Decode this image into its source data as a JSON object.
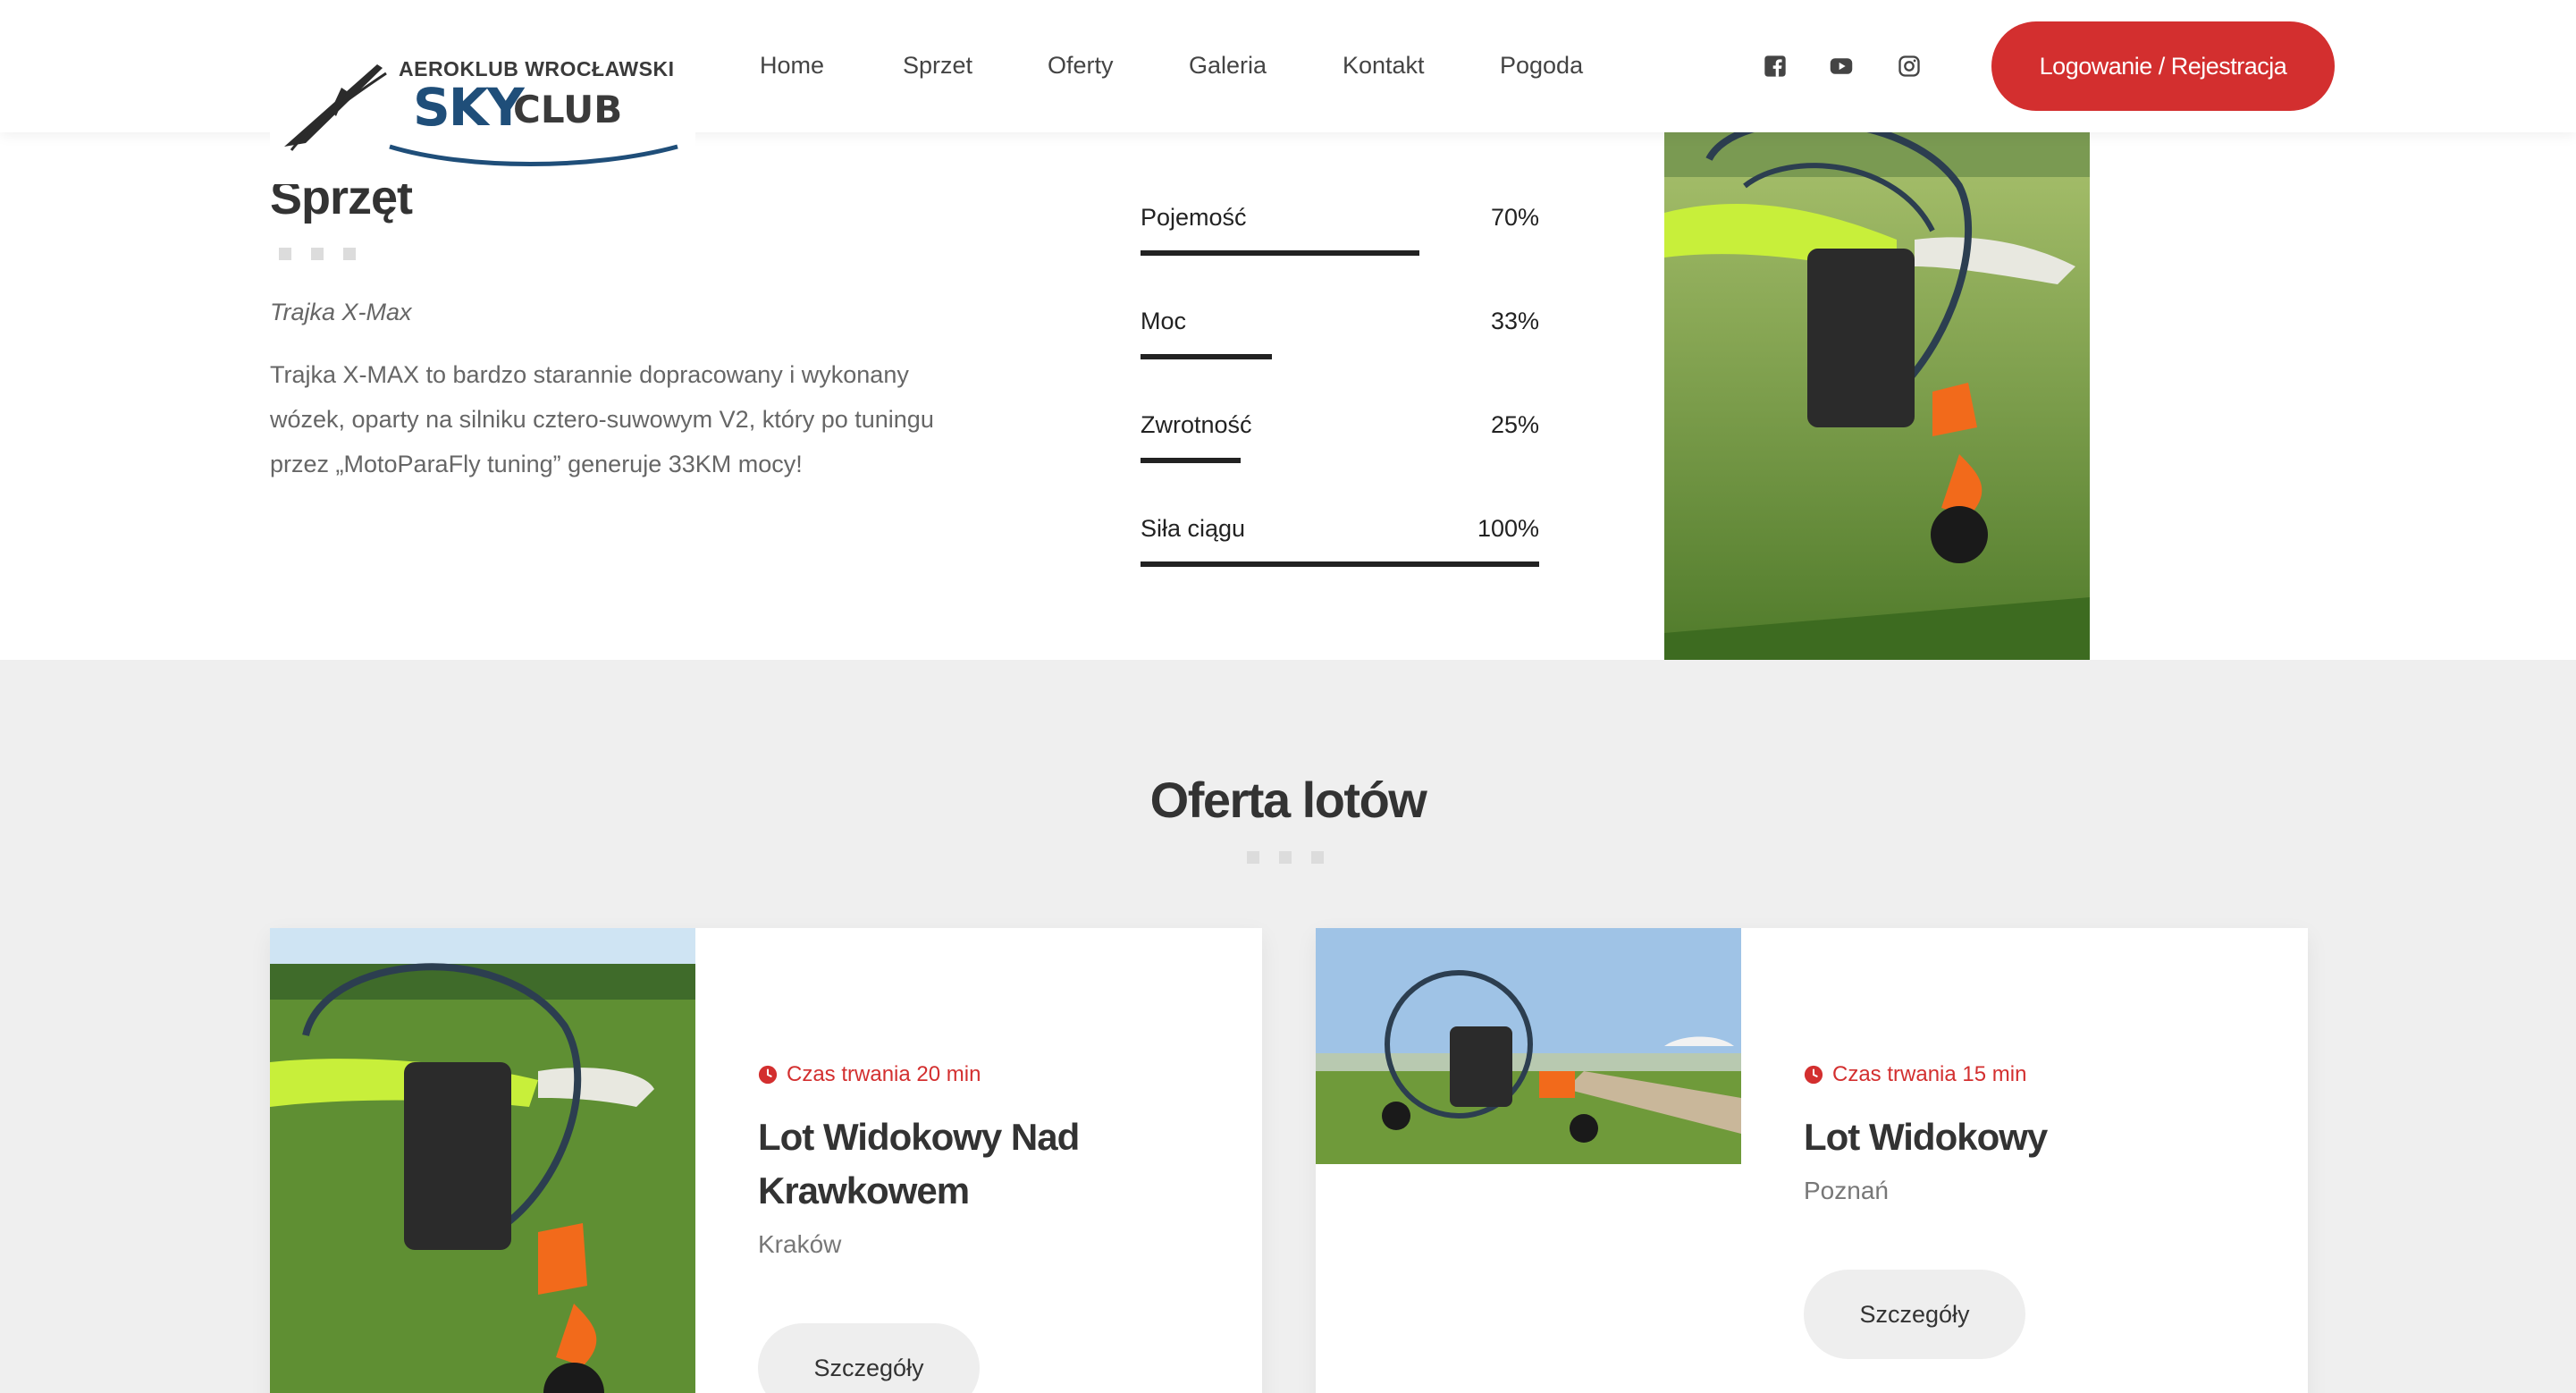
{
  "header": {
    "logo": {
      "top_text": "AEROKLUB WROCŁAWSKI",
      "sky": "SKY",
      "club": "CLUB"
    },
    "nav": [
      "Home",
      "Sprzet",
      "Oferty",
      "Galeria",
      "Kontakt",
      "Pogoda"
    ],
    "social_icons": [
      "facebook-icon",
      "youtube-icon",
      "instagram-icon"
    ],
    "login_label": "Logowanie / Rejestracja"
  },
  "equipment": {
    "title": "Sprzęt",
    "subtitle": "Trajka X-Max",
    "description": "Trajka X-MAX to bardzo starannie dopracowany i wykonany wózek, oparty na silniku cztero-suwowym V2, który po tuningu przez „MotoParaFly tuning” generuje 33KM mocy!",
    "skills": [
      {
        "label": "Pojemość",
        "value": "70%",
        "level": 0.7
      },
      {
        "label": "Moc",
        "value": "33%",
        "level": 0.33
      },
      {
        "label": "Zwrotność",
        "value": "25%",
        "level": 0.25
      },
      {
        "label": "Siła ciągu",
        "value": "100%",
        "level": 1.0
      }
    ]
  },
  "offers": {
    "title": "Oferta lotów",
    "cards": [
      {
        "time": "Czas trwania 20 min",
        "title": "Lot Widokowy Nad Krawkowem",
        "city": "Kraków",
        "button": "Szczegóły"
      },
      {
        "time": "Czas trwania 15 min",
        "title": "Lot Widokowy",
        "city": "Poznań",
        "button": "Szczegóły"
      }
    ]
  },
  "colors": {
    "accent": "#d32f2f",
    "brand": "#1f4e79",
    "section_bg": "#efefef"
  }
}
